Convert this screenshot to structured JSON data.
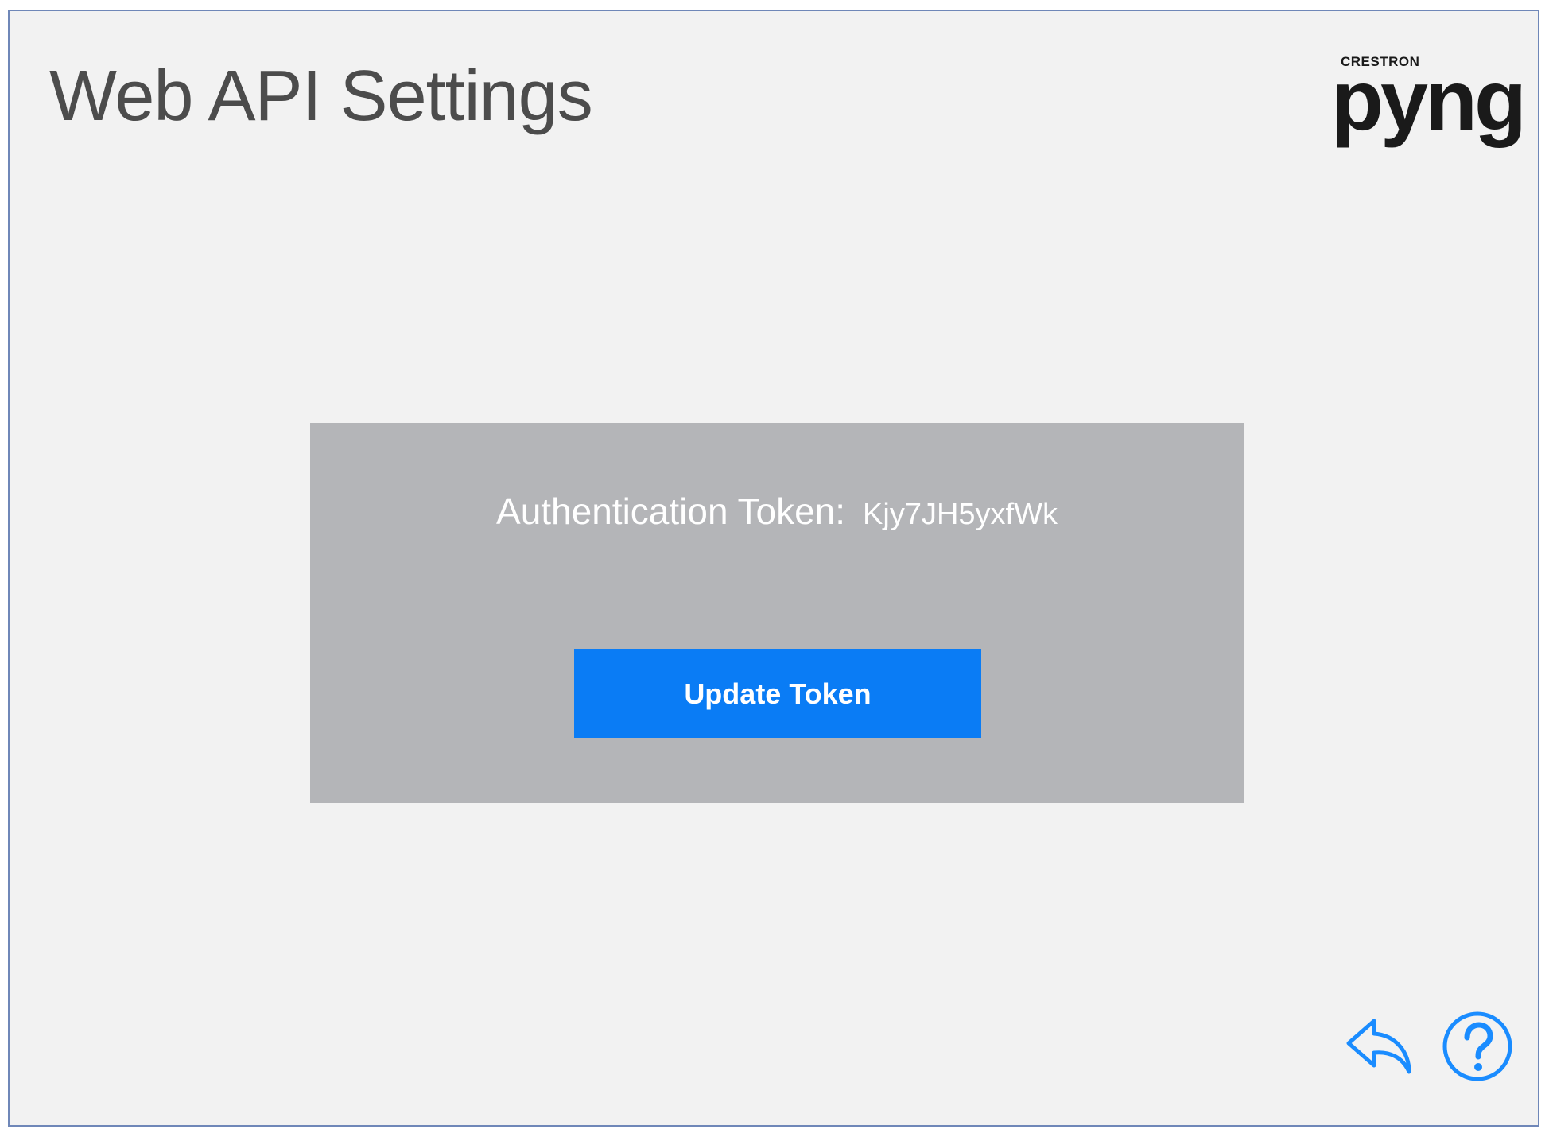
{
  "header": {
    "title": "Web API Settings"
  },
  "brand": {
    "sub_label": "CRESTRON",
    "name": "pyng"
  },
  "token_panel": {
    "label": "Authentication Token:",
    "value": "Kjy7JH5yxfWk",
    "update_button_label": "Update Token"
  },
  "footer": {
    "back_icon": "back-arrow-icon",
    "help_icon": "help-circle-icon"
  },
  "colors": {
    "background": "#f2f2f2",
    "panel": "#b4b5b8",
    "button": "#0a7cf5",
    "icon": "#1a8cff",
    "title_text": "#4c4c4c"
  }
}
